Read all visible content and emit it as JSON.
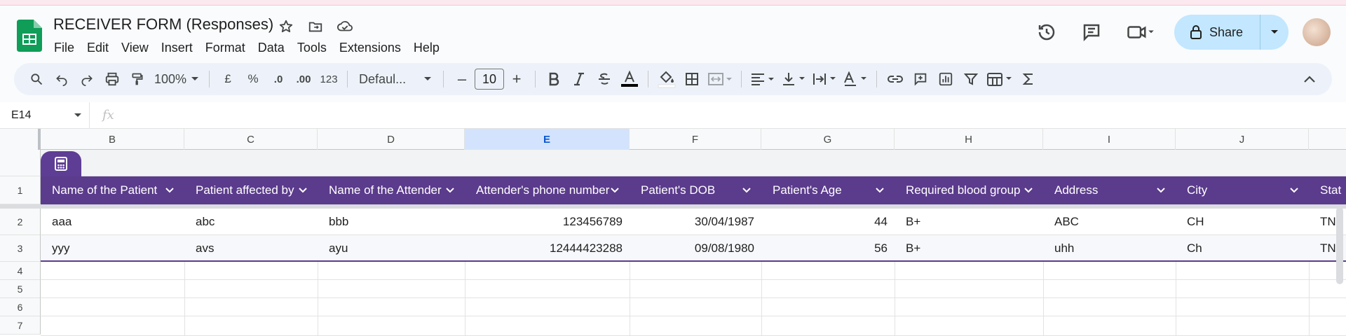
{
  "app": {
    "title": "RECEIVER FORM (Responses)",
    "accent": "#5b3b8c"
  },
  "menu": [
    "File",
    "Edit",
    "View",
    "Insert",
    "Format",
    "Data",
    "Tools",
    "Extensions",
    "Help"
  ],
  "header_right": {
    "share_label": "Share"
  },
  "toolbar": {
    "zoom": "100%",
    "currency": "£",
    "percent": "%",
    "dec_decrease": ".0",
    "dec_increase": ".00",
    "number_format": "123",
    "font": "Defaul...",
    "font_size": "10",
    "minus": "–",
    "plus": "+"
  },
  "formula_bar": {
    "cell_ref": "E14",
    "fx": "fx",
    "value": ""
  },
  "columns": [
    "B",
    "C",
    "D",
    "E",
    "F",
    "G",
    "H",
    "I",
    "J"
  ],
  "selected_column": "E",
  "row_numbers": [
    "1",
    "2",
    "3",
    "4",
    "5",
    "6",
    "7"
  ],
  "table": {
    "headers": [
      "Name of the Patient",
      "Patient affected by",
      "Name of the Attender",
      "Attender's phone number",
      "Patient's DOB",
      "Patient's Age",
      "Required blood group",
      "Address",
      "City",
      "Stat"
    ],
    "rows": [
      [
        "aaa",
        "abc",
        "bbb",
        "123456789",
        "30/04/1987",
        "44",
        "B+",
        "ABC",
        "CH",
        "TN"
      ],
      [
        "yyy",
        "avs",
        "ayu",
        "12444423288",
        "09/08/1980",
        "56",
        "B+",
        "uhh",
        "Ch",
        "TN"
      ]
    ]
  }
}
